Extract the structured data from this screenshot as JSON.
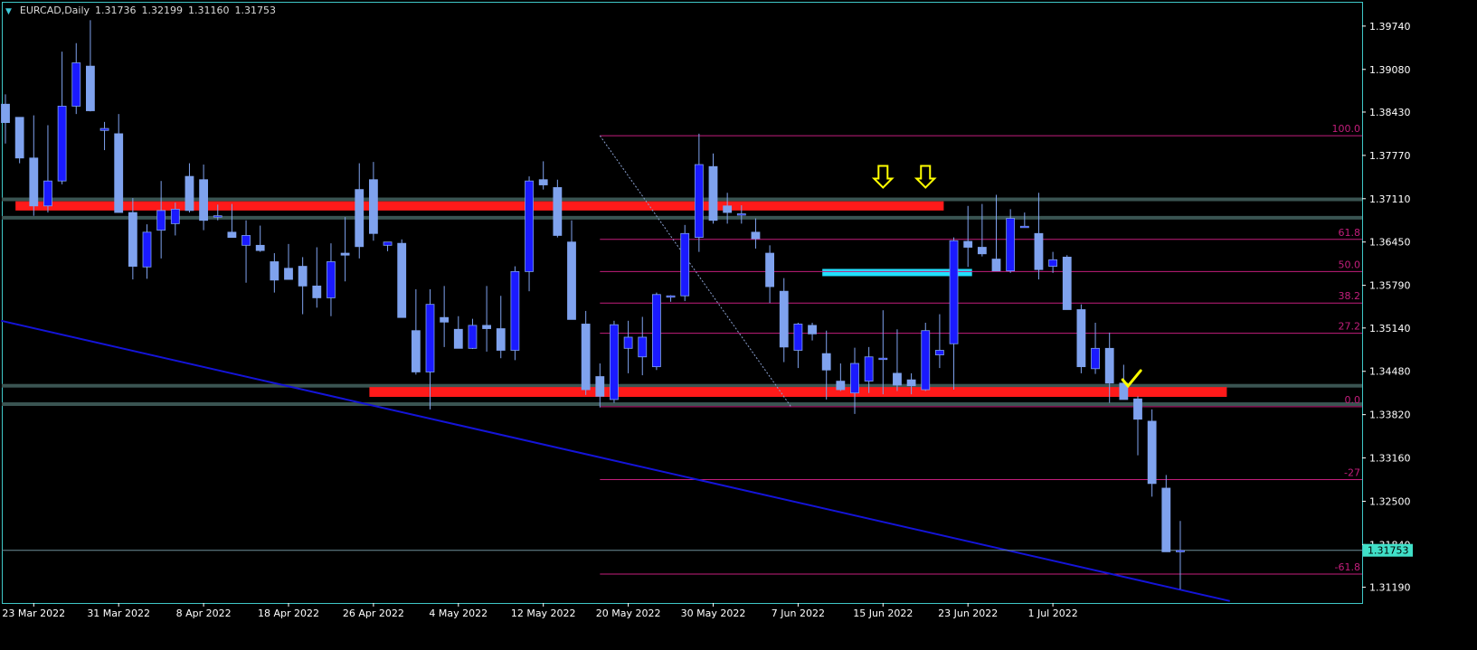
{
  "header": {
    "symbol": "EURCAD,Daily",
    "open": "1.31736",
    "high": "1.32199",
    "low": "1.31160",
    "close": "1.31753",
    "arrow_icon": "dropdown-triangle-icon"
  },
  "colors": {
    "background": "#000000",
    "frame": "#3fc8c8",
    "axis_text": "#ffffff",
    "bull_body": "#1a1aff",
    "bear_body": "#7fa2ee",
    "wick": "#7fa2ee",
    "zone_red": "#ff1a1a",
    "zone_cyan": "#22e0ff",
    "zone_border": "#3a5452",
    "fib": "#c31e7c",
    "trendline": "#1414d8",
    "current_price_bg": "#40e0c8",
    "arrow": "#ffff00",
    "check": "#ffff00"
  },
  "chart_data": {
    "type": "candlestick",
    "title": "EURCAD,Daily",
    "ylim": [
      1.3095,
      1.4011
    ],
    "y_ticks": [
      "1.39740",
      "1.39080",
      "1.38430",
      "1.37770",
      "1.37110",
      "1.36450",
      "1.35790",
      "1.35140",
      "1.34480",
      "1.33820",
      "1.33160",
      "1.32500",
      "1.31840",
      "1.31190"
    ],
    "x_ticks": [
      {
        "label": "23 Mar 2022",
        "bar": 2
      },
      {
        "label": "31 Mar 2022",
        "bar": 8
      },
      {
        "label": "8 Apr 2022",
        "bar": 14
      },
      {
        "label": "18 Apr 2022",
        "bar": 20
      },
      {
        "label": "26 Apr 2022",
        "bar": 26
      },
      {
        "label": "4 May 2022",
        "bar": 32
      },
      {
        "label": "12 May 2022",
        "bar": 38
      },
      {
        "label": "20 May 2022",
        "bar": 44
      },
      {
        "label": "30 May 2022",
        "bar": 50
      },
      {
        "label": "7 Jun 2022",
        "bar": 56
      },
      {
        "label": "15 Jun 2022",
        "bar": 62
      },
      {
        "label": "23 Jun 2022",
        "bar": 68
      },
      {
        "label": "1 Jul 2022",
        "bar": 74
      }
    ],
    "candles": [
      [
        1.3855,
        1.387,
        1.3795,
        1.3827
      ],
      [
        1.3835,
        1.3835,
        1.3765,
        1.3773
      ],
      [
        1.3773,
        1.3838,
        1.3685,
        1.37
      ],
      [
        1.37,
        1.3823,
        1.369,
        1.3738
      ],
      [
        1.3738,
        1.3935,
        1.3733,
        1.3852
      ],
      [
        1.3852,
        1.3948,
        1.384,
        1.3918
      ],
      [
        1.3913,
        1.3983,
        1.3844,
        1.3845
      ],
      [
        1.3815,
        1.3828,
        1.3785,
        1.3818
      ],
      [
        1.381,
        1.384,
        1.369,
        1.369
      ],
      [
        1.369,
        1.3712,
        1.3588,
        1.3608
      ],
      [
        1.3607,
        1.3672,
        1.3589,
        1.366
      ],
      [
        1.3663,
        1.3738,
        1.362,
        1.3693
      ],
      [
        1.3673,
        1.3705,
        1.3655,
        1.3695
      ],
      [
        1.3745,
        1.3765,
        1.369,
        1.3693
      ],
      [
        1.374,
        1.3763,
        1.3663,
        1.3678
      ],
      [
        1.3683,
        1.3702,
        1.3678,
        1.3685
      ],
      [
        1.366,
        1.3703,
        1.3655,
        1.3652
      ],
      [
        1.364,
        1.3678,
        1.3583,
        1.3655
      ],
      [
        1.364,
        1.367,
        1.363,
        1.3632
      ],
      [
        1.3615,
        1.3628,
        1.3568,
        1.3587
      ],
      [
        1.3605,
        1.3642,
        1.3588,
        1.3588
      ],
      [
        1.3608,
        1.3622,
        1.3535,
        1.3578
      ],
      [
        1.3578,
        1.3637,
        1.3545,
        1.356
      ],
      [
        1.356,
        1.3643,
        1.3532,
        1.3615
      ],
      [
        1.3628,
        1.3683,
        1.3585,
        1.3625
      ],
      [
        1.3725,
        1.3765,
        1.362,
        1.3638
      ],
      [
        1.374,
        1.3767,
        1.3647,
        1.3658
      ],
      [
        1.364,
        1.3645,
        1.3631,
        1.3645
      ],
      [
        1.3643,
        1.3649,
        1.353,
        1.353
      ],
      [
        1.351,
        1.3573,
        1.3443,
        1.3447
      ],
      [
        1.3447,
        1.3573,
        1.339,
        1.355
      ],
      [
        1.353,
        1.3578,
        1.3485,
        1.3523
      ],
      [
        1.3512,
        1.3532,
        1.3483,
        1.3483
      ],
      [
        1.3483,
        1.3528,
        1.3482,
        1.3518
      ],
      [
        1.3518,
        1.3578,
        1.3478,
        1.3513
      ],
      [
        1.3513,
        1.3563,
        1.3468,
        1.348
      ],
      [
        1.348,
        1.3608,
        1.3465,
        1.36
      ],
      [
        1.36,
        1.3745,
        1.357,
        1.3738
      ],
      [
        1.374,
        1.3768,
        1.3725,
        1.3732
      ],
      [
        1.3728,
        1.374,
        1.3652,
        1.3655
      ],
      [
        1.3645,
        1.3678,
        1.3527,
        1.3527
      ],
      [
        1.352,
        1.354,
        1.3412,
        1.342
      ],
      [
        1.344,
        1.346,
        1.3393,
        1.341
      ],
      [
        1.3405,
        1.3525,
        1.34,
        1.3519
      ],
      [
        1.3483,
        1.3525,
        1.3445,
        1.35
      ],
      [
        1.347,
        1.3531,
        1.3442,
        1.35
      ],
      [
        1.3455,
        1.3568,
        1.345,
        1.3565
      ],
      [
        1.3563,
        1.3564,
        1.3554,
        1.3563
      ],
      [
        1.3563,
        1.3671,
        1.3555,
        1.3658
      ],
      [
        1.3652,
        1.381,
        1.363,
        1.3763
      ],
      [
        1.376,
        1.378,
        1.3673,
        1.3678
      ],
      [
        1.37,
        1.372,
        1.3673,
        1.369
      ],
      [
        1.3688,
        1.3701,
        1.3673,
        1.3688
      ],
      [
        1.366,
        1.3681,
        1.3635,
        1.365
      ],
      [
        1.3628,
        1.364,
        1.3552,
        1.3577
      ],
      [
        1.357,
        1.359,
        1.3462,
        1.3485
      ],
      [
        1.348,
        1.3522,
        1.3453,
        1.352
      ],
      [
        1.3518,
        1.3522,
        1.3495,
        1.3505
      ],
      [
        1.3475,
        1.351,
        1.3405,
        1.345
      ],
      [
        1.3433,
        1.346,
        1.3418,
        1.342
      ],
      [
        1.3415,
        1.3484,
        1.3383,
        1.346
      ],
      [
        1.3433,
        1.3485,
        1.3415,
        1.347
      ],
      [
        1.3468,
        1.3541,
        1.3413,
        1.3468
      ],
      [
        1.3445,
        1.3512,
        1.3418,
        1.3427
      ],
      [
        1.3435,
        1.3445,
        1.3413,
        1.3426
      ],
      [
        1.342,
        1.3522,
        1.3418,
        1.351
      ],
      [
        1.3473,
        1.3535,
        1.3453,
        1.348
      ],
      [
        1.349,
        1.3652,
        1.342,
        1.3647
      ],
      [
        1.3646,
        1.37,
        1.3607,
        1.3637
      ],
      [
        1.3637,
        1.3703,
        1.3623,
        1.3627
      ],
      [
        1.3619,
        1.3717,
        1.3608,
        1.3601
      ],
      [
        1.3601,
        1.3695,
        1.3598,
        1.3681
      ],
      [
        1.3669,
        1.369,
        1.3668,
        1.3669
      ],
      [
        1.3658,
        1.372,
        1.3588,
        1.3603
      ],
      [
        1.3608,
        1.363,
        1.3598,
        1.3618
      ],
      [
        1.3622,
        1.3625,
        1.357,
        1.3542
      ],
      [
        1.3542,
        1.355,
        1.3445,
        1.3455
      ],
      [
        1.3452,
        1.3522,
        1.3444,
        1.3483
      ],
      [
        1.3483,
        1.3507,
        1.34,
        1.343
      ],
      [
        1.343,
        1.3458,
        1.341,
        1.3405
      ],
      [
        1.3406,
        1.341,
        1.332,
        1.3375
      ],
      [
        1.3372,
        1.339,
        1.3257,
        1.3277
      ],
      [
        1.327,
        1.329,
        1.3175,
        1.3173
      ],
      [
        1.3174,
        1.322,
        1.3116,
        1.3175
      ]
    ],
    "zones": [
      {
        "type": "resistance",
        "from_bar": 1,
        "to_bar": 66,
        "y_top": 1.3707,
        "y_bottom": 1.3693,
        "color": "red"
      },
      {
        "type": "support",
        "from_bar": 26,
        "to_bar": 86,
        "y_top": 1.3424,
        "y_bottom": 1.3409,
        "color": "red"
      },
      {
        "type": "range",
        "from_bar": 58,
        "to_bar": 68,
        "y_top": 1.3604,
        "y_bottom": 1.3593,
        "color": "cyan"
      }
    ],
    "grey_levels": [
      1.371,
      1.3682,
      1.3426,
      1.3398
    ],
    "fibonacci": {
      "from_bar": 42,
      "levels": [
        {
          "label": "100.0",
          "price": 1.3807
        },
        {
          "label": "61.8",
          "price": 1.3649
        },
        {
          "label": "50.0",
          "price": 1.36
        },
        {
          "label": "38.2",
          "price": 1.3552
        },
        {
          "label": "27.2",
          "price": 1.3506
        },
        {
          "label": "0.0",
          "price": 1.3394
        },
        {
          "label": "-27",
          "price": 1.3283
        },
        {
          "label": "-61.8",
          "price": 1.3139
        }
      ]
    },
    "trendline": {
      "bar1": -0.3,
      "price1": 1.3525,
      "bar2": 86.5,
      "price2": 1.3098
    },
    "current_price": "1.31753",
    "current_price_value": 1.31753,
    "annotations": [
      {
        "type": "down-arrow",
        "bar": 62,
        "price": 1.3728
      },
      {
        "type": "down-arrow",
        "bar": 65,
        "price": 1.3728
      },
      {
        "type": "checkmark",
        "bar": 79.5,
        "price": 1.3427
      }
    ]
  }
}
